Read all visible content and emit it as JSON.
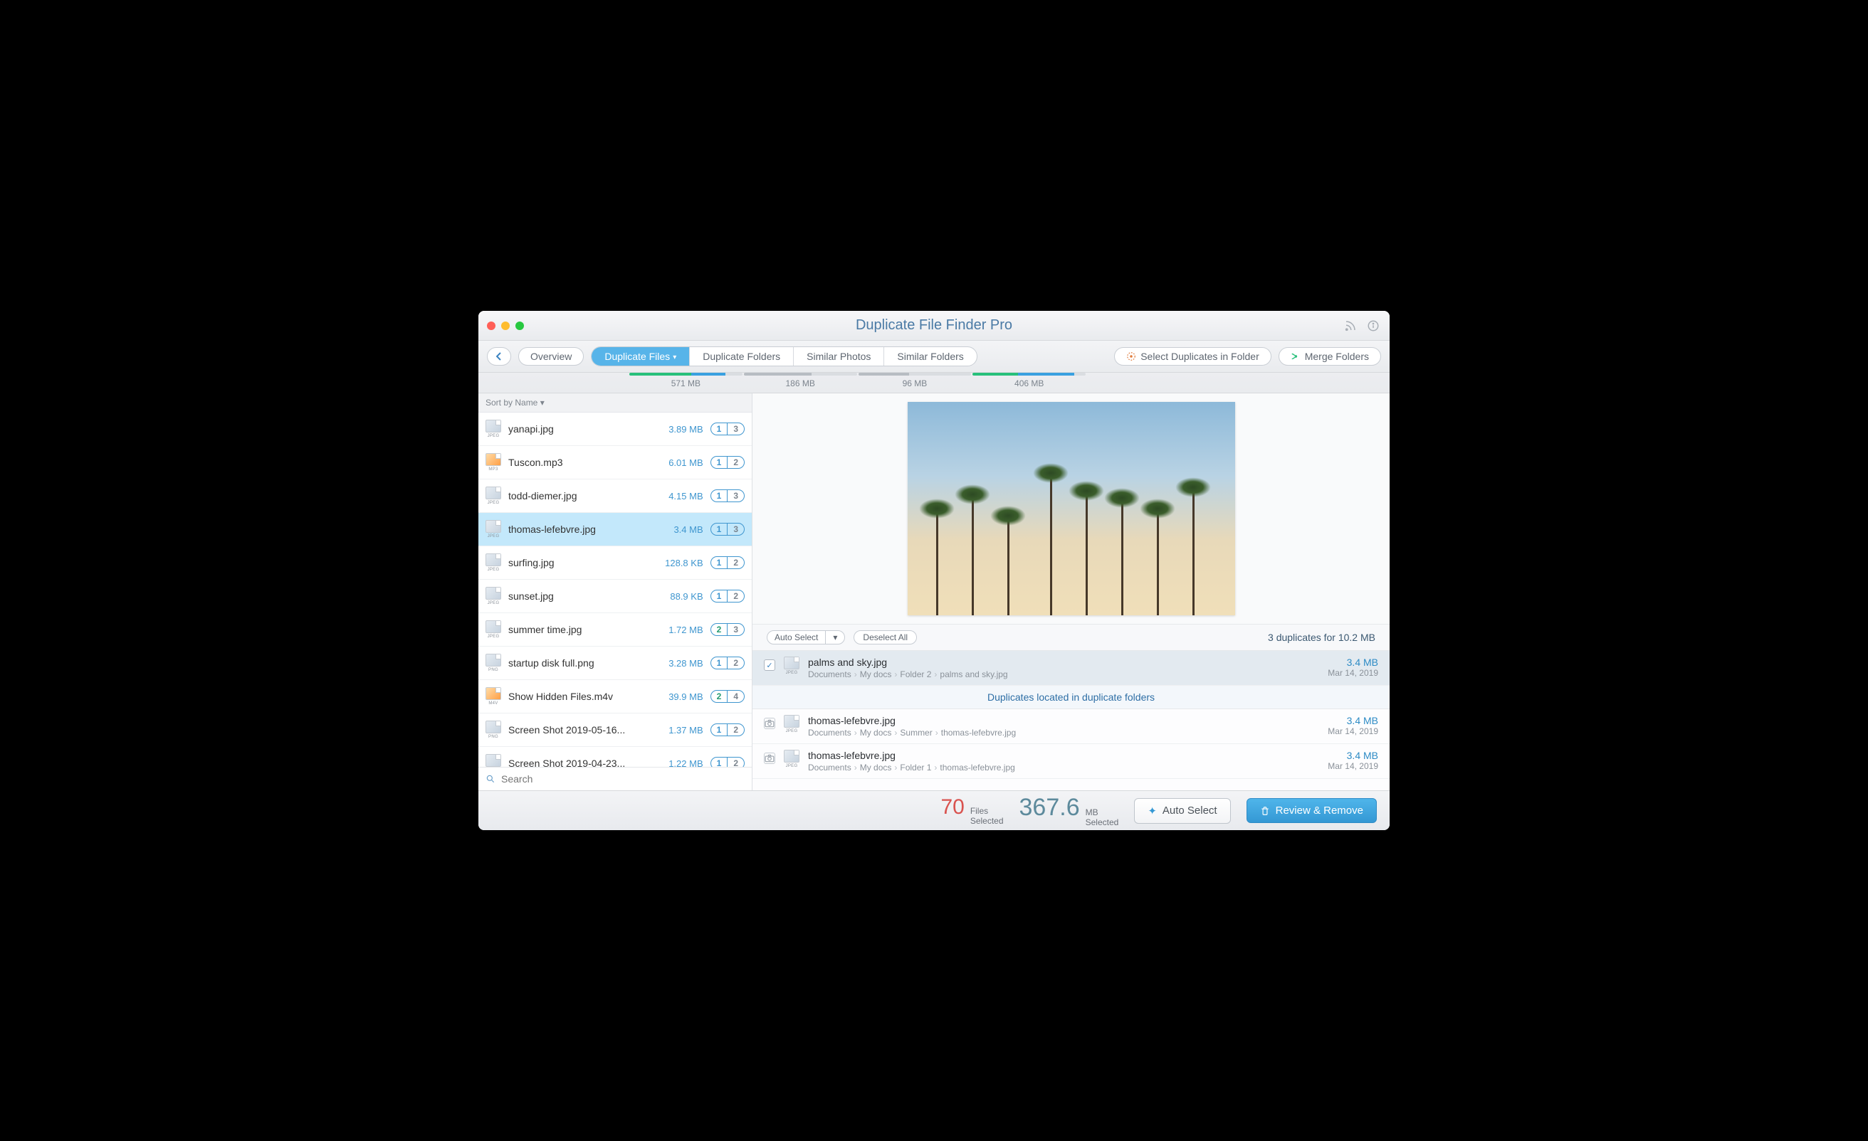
{
  "window": {
    "title": "Duplicate File Finder Pro"
  },
  "toolbar": {
    "overview": "Overview",
    "tabs": [
      {
        "label": "Duplicate Files",
        "active": true
      },
      {
        "label": "Duplicate Folders",
        "active": false
      },
      {
        "label": "Similar Photos",
        "active": false
      },
      {
        "label": "Similar Folders",
        "active": false
      }
    ],
    "select_in_folder": "Select Duplicates in Folder",
    "merge_folders": "Merge Folders"
  },
  "progress": [
    {
      "label": "571 MB",
      "colors": [
        "#28c07b",
        "#3aa0e0"
      ],
      "pct": [
        55,
        30
      ]
    },
    {
      "label": "186 MB",
      "colors": [
        "#b7bcc2"
      ],
      "pct": [
        60
      ]
    },
    {
      "label": "96 MB",
      "colors": [
        "#b7bcc2"
      ],
      "pct": [
        45
      ]
    },
    {
      "label": "406 MB",
      "colors": [
        "#28c07b",
        "#3aa0e0"
      ],
      "pct": [
        40,
        50
      ]
    }
  ],
  "sidebar": {
    "sort_label": "Sort by Name ▾",
    "search_placeholder": "Search",
    "items": [
      {
        "name": "yanapi.jpg",
        "size": "3.89 MB",
        "a": "1",
        "b": "3",
        "ext": "JPEG",
        "selected": false
      },
      {
        "name": "Tuscon.mp3",
        "size": "6.01 MB",
        "a": "1",
        "b": "2",
        "ext": "MP3",
        "selected": false,
        "media": true
      },
      {
        "name": "todd-diemer.jpg",
        "size": "4.15 MB",
        "a": "1",
        "b": "3",
        "ext": "JPEG",
        "selected": false
      },
      {
        "name": "thomas-lefebvre.jpg",
        "size": "3.4 MB",
        "a": "1",
        "b": "3",
        "ext": "JPEG",
        "selected": true
      },
      {
        "name": "surfing.jpg",
        "size": "128.8 KB",
        "a": "1",
        "b": "2",
        "ext": "JPEG",
        "selected": false
      },
      {
        "name": "sunset.jpg",
        "size": "88.9 KB",
        "a": "1",
        "b": "2",
        "ext": "JPEG",
        "selected": false
      },
      {
        "name": "summer time.jpg",
        "size": "1.72 MB",
        "a": "2",
        "b": "3",
        "ext": "JPEG",
        "selected": false,
        "ahl": true
      },
      {
        "name": "startup disk full.png",
        "size": "3.28 MB",
        "a": "1",
        "b": "2",
        "ext": "PNG",
        "selected": false
      },
      {
        "name": "Show Hidden Files.m4v",
        "size": "39.9 MB",
        "a": "2",
        "b": "4",
        "ext": "M4V",
        "selected": false,
        "media": true,
        "ahl": true
      },
      {
        "name": "Screen Shot 2019-05-16...",
        "size": "1.37 MB",
        "a": "1",
        "b": "2",
        "ext": "PNG",
        "selected": false
      },
      {
        "name": "Screen Shot 2019-04-23...",
        "size": "1.22 MB",
        "a": "1",
        "b": "2",
        "ext": "PNG",
        "selected": false
      }
    ]
  },
  "detail": {
    "auto_select": "Auto Select",
    "deselect_all": "Deselect All",
    "summary": "3 duplicates for 10.2 MB",
    "banner": "Duplicates located in duplicate folders",
    "rows": [
      {
        "checked": true,
        "name": "palms and sky.jpg",
        "path": [
          "Documents",
          "My docs",
          "Folder 2",
          "palms and sky.jpg"
        ],
        "size": "3.4 MB",
        "date": "Mar 14, 2019",
        "highlight": true
      },
      {
        "cam": true,
        "name": "thomas-lefebvre.jpg",
        "path": [
          "Documents",
          "My docs",
          "Summer",
          "thomas-lefebvre.jpg"
        ],
        "size": "3.4 MB",
        "date": "Mar 14, 2019"
      },
      {
        "cam": true,
        "name": "thomas-lefebvre.jpg",
        "path": [
          "Documents",
          "My docs",
          "Folder 1",
          "thomas-lefebvre.jpg"
        ],
        "size": "3.4 MB",
        "date": "Mar 14, 2019"
      }
    ]
  },
  "footer": {
    "files_count": "70",
    "files_label1": "Files",
    "files_label2": "Selected",
    "mb_count": "367.6",
    "mb_label1": "MB",
    "mb_label2": "Selected",
    "auto_select": "Auto Select",
    "review": "Review & Remove"
  }
}
